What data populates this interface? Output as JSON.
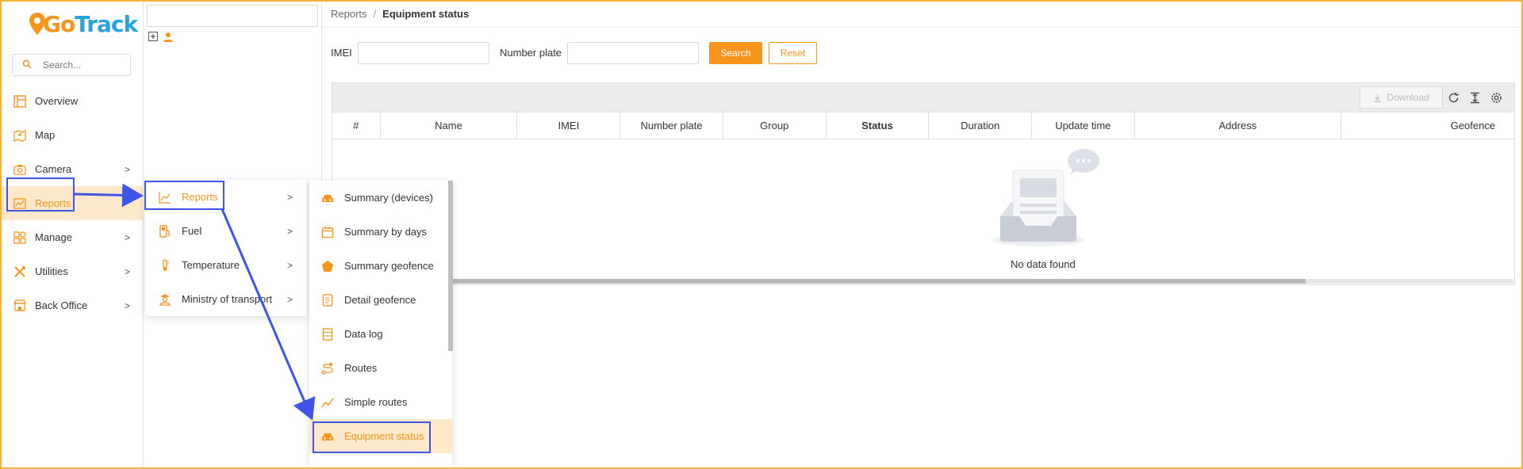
{
  "brand": {
    "logo_go": "Go",
    "logo_track": "Track"
  },
  "sidebar": {
    "search_placeholder": "Search...",
    "items": [
      {
        "label": "Overview",
        "icon": "layout-icon",
        "has_submenu": false
      },
      {
        "label": "Map",
        "icon": "map-icon",
        "has_submenu": false
      },
      {
        "label": "Camera",
        "icon": "camera-icon",
        "has_submenu": true
      },
      {
        "label": "Reports",
        "icon": "chart-icon",
        "has_submenu": true,
        "active": true
      },
      {
        "label": "Manage",
        "icon": "grid-icon",
        "has_submenu": true
      },
      {
        "label": "Utilities",
        "icon": "tools-icon",
        "has_submenu": true
      },
      {
        "label": "Back Office",
        "icon": "store-icon",
        "has_submenu": true
      }
    ],
    "chevron": ">"
  },
  "breadcrumb": {
    "parent": "Reports",
    "separator": "/",
    "current": "Equipment status"
  },
  "filters": {
    "imei_label": "IMEI",
    "imei_value": "",
    "plate_label": "Number plate",
    "plate_value": "",
    "search_label": "Search",
    "reset_label": "Reset"
  },
  "table": {
    "download_label": "Download",
    "columns": [
      "#",
      "Name",
      "IMEI",
      "Number plate",
      "Group",
      "Status",
      "Duration",
      "Update time",
      "Address",
      "Geofence"
    ],
    "empty_text": "No data found"
  },
  "flyout_reports": {
    "items": [
      {
        "label": "Reports",
        "icon": "line-chart-icon",
        "active": true
      },
      {
        "label": "Fuel",
        "icon": "fuel-icon"
      },
      {
        "label": "Temperature",
        "icon": "thermometer-icon"
      },
      {
        "label": "Ministry of transport",
        "icon": "officer-icon"
      }
    ]
  },
  "flyout_sub": {
    "items": [
      {
        "label": "Summary (devices)",
        "icon": "car-icon"
      },
      {
        "label": "Summary by days",
        "icon": "calendar-icon"
      },
      {
        "label": "Summary geofence",
        "icon": "pentagon-icon"
      },
      {
        "label": "Detail geofence",
        "icon": "document-icon"
      },
      {
        "label": "Data log",
        "icon": "list-icon"
      },
      {
        "label": "Routes",
        "icon": "route-icon"
      },
      {
        "label": "Simple routes",
        "icon": "trend-icon"
      },
      {
        "label": "Equipment status",
        "icon": "car-icon",
        "active": true
      }
    ]
  },
  "colors": {
    "accent": "#f7941d",
    "brand_blue": "#29a3de",
    "annotation": "#3f55e8",
    "active_bg": "#fde9c9"
  }
}
